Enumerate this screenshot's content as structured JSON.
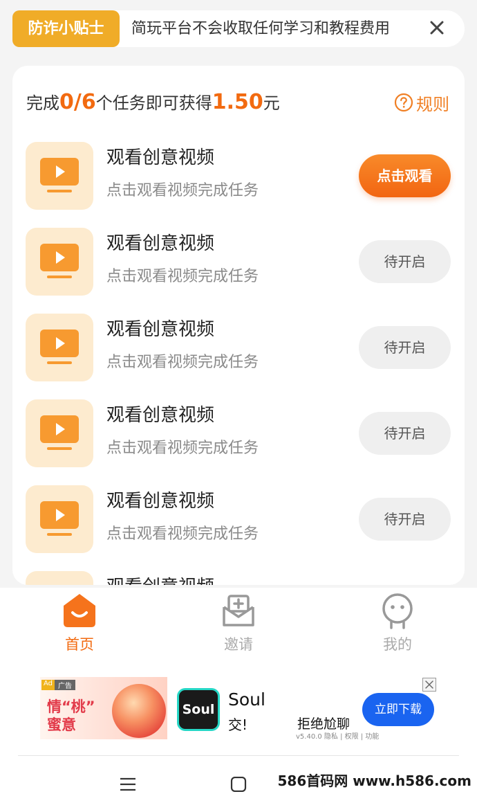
{
  "notice": {
    "tag": "防诈小贴士",
    "text": "简玩平台不会收取任何学习和教程费用",
    "close_icon": "close-icon"
  },
  "task_panel": {
    "progress_prefix": "完成",
    "progress_count": "0/6",
    "progress_middle": "个任务即可获得",
    "reward": "1.50",
    "progress_unit": "元",
    "rules_label": "规则",
    "tasks": [
      {
        "title": "观看创意视频",
        "subtitle": "点击观看视频完成任务",
        "button": "点击观看",
        "state": "active"
      },
      {
        "title": "观看创意视频",
        "subtitle": "点击观看视频完成任务",
        "button": "待开启",
        "state": "pending"
      },
      {
        "title": "观看创意视频",
        "subtitle": "点击观看视频完成任务",
        "button": "待开启",
        "state": "pending"
      },
      {
        "title": "观看创意视频",
        "subtitle": "点击观看视频完成任务",
        "button": "待开启",
        "state": "pending"
      },
      {
        "title": "观看创意视频",
        "subtitle": "点击观看视频完成任务",
        "button": "待开启",
        "state": "pending"
      },
      {
        "title": "观看创意视频",
        "subtitle": "",
        "button": "",
        "state": "pending"
      }
    ]
  },
  "bottom_nav": {
    "items": [
      {
        "label": "首页",
        "icon": "home-icon",
        "active": true
      },
      {
        "label": "邀请",
        "icon": "invite-icon",
        "active": false
      },
      {
        "label": "我的",
        "icon": "profile-icon",
        "active": false
      }
    ]
  },
  "ad": {
    "badge_ad": "Ad",
    "badge_label": "广告",
    "slogan_line1": "情“桃”",
    "slogan_line2": "蜜意",
    "app_icon_text": "Soul",
    "app_name": "Soul",
    "app_sub": "交!",
    "headline": "拒绝尬聊",
    "meta": "v5.40.0 隐私 | 权限 | 功能",
    "cta": "立即下载"
  },
  "watermark": "586首码网 www.h586.com",
  "colors": {
    "accent": "#f26a10",
    "notice_tag": "#f0ac28",
    "cta_blue": "#1a64f0"
  }
}
